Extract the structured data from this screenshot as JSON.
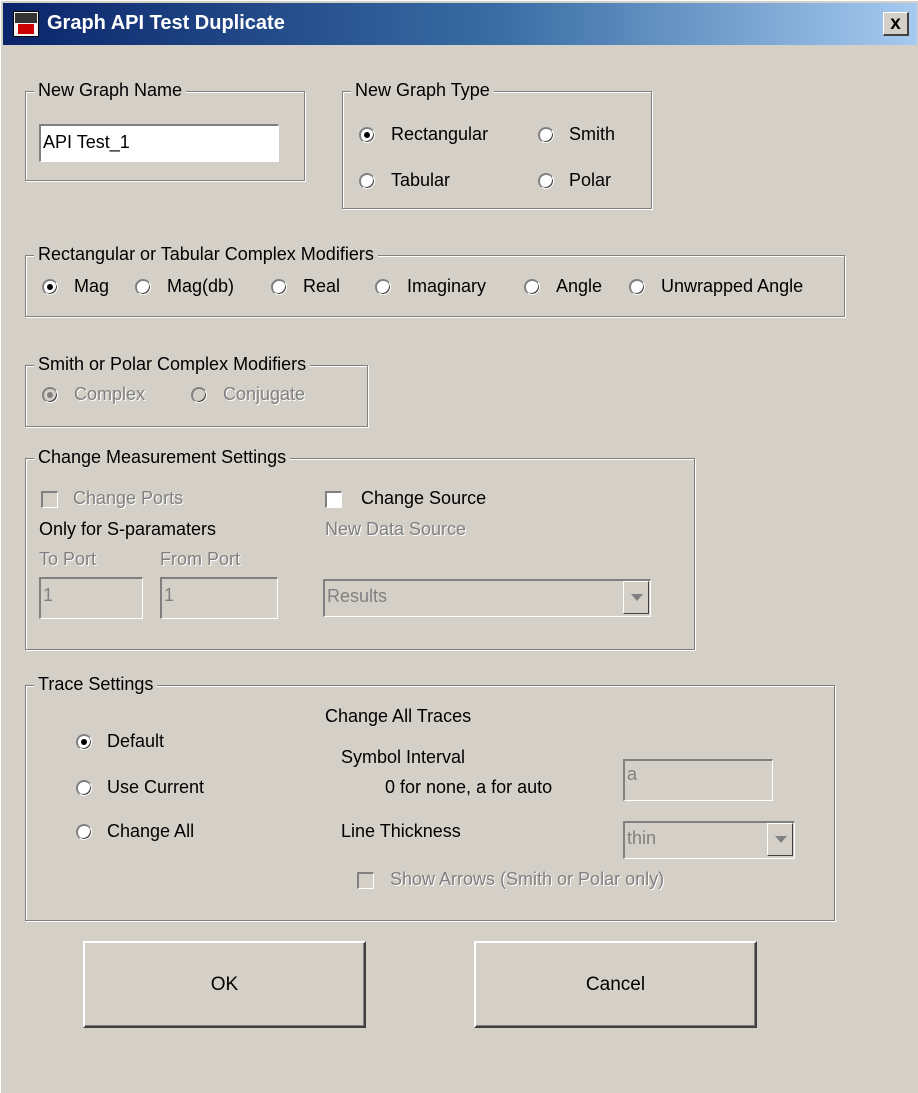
{
  "window": {
    "title": "Graph API Test Duplicate",
    "close_label": "x"
  },
  "new_graph_name": {
    "legend": "New Graph Name",
    "value": "API Test_1"
  },
  "new_graph_type": {
    "legend": "New Graph Type",
    "options": [
      "Rectangular",
      "Smith",
      "Tabular",
      "Polar"
    ],
    "selected": "Rectangular"
  },
  "rect_modifiers": {
    "legend": "Rectangular or Tabular Complex Modifiers",
    "options": [
      "Mag",
      "Mag(db)",
      "Real",
      "Imaginary",
      "Angle",
      "Unwrapped Angle"
    ],
    "selected": "Mag"
  },
  "smith_modifiers": {
    "legend": "Smith or Polar Complex Modifiers",
    "options": [
      "Complex",
      "Conjugate"
    ],
    "selected": "Complex",
    "enabled": false
  },
  "measurement": {
    "legend": "Change Measurement Settings",
    "change_ports_label": "Change Ports",
    "only_for_label": "Only for S-paramaters",
    "to_port_label": "To Port",
    "from_port_label": "From Port",
    "to_port_value": "1",
    "from_port_value": "1",
    "change_source_label": "Change Source",
    "new_data_source_label": "New Data Source",
    "data_source_value": "Results"
  },
  "trace": {
    "legend": "Trace Settings",
    "heading": "Change All Traces",
    "options": [
      "Default",
      "Use Current",
      "Change All"
    ],
    "selected": "Default",
    "symbol_interval_label": "Symbol Interval",
    "symbol_hint_label": "0 for none, a for auto",
    "symbol_interval_value": "a",
    "line_thickness_label": "Line Thickness",
    "line_thickness_value": "thin",
    "show_arrows_label": "Show Arrows (Smith or Polar only)"
  },
  "buttons": {
    "ok_label": "OK",
    "cancel_label": "Cancel"
  }
}
